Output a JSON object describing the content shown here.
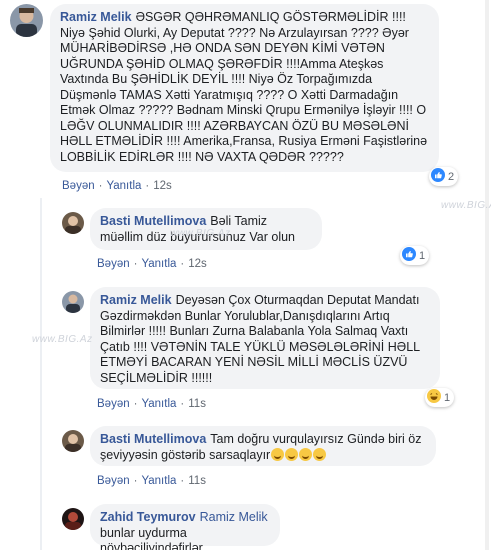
{
  "comments": [
    {
      "author": "Ramiz Melik",
      "text": "ƏSGƏR QƏHRƏMANLIQ GÖSTƏRMƏLİDİR !!!! Niyə Şəhid Olurki, Ay Deputat ???? Nə Arzulayırsan ???? Əyər MÜHARİBƏDİRSƏ ,HƏ ONDA SƏN DEYƏN KİMİ VƏTƏN UĞRUNDA ŞƏHİD OLMAQ ŞƏRƏFDİR !!!!Amma Ateşkəs Vaxtında Bu ŞƏHİDLİK DEYİL !!!! Niyə Öz Torpağımızda Düşmənlə TAMAS Xətti Yaratmışıq ???? O Xətti Darmadağın Etmək Olmaz ????? Bədnam Minski Qrupu Ermənilyə İşləyir !!!! O LƏĞV OLUNMALIDIR !!!! AZƏRBAYCAN ÖZÜ BU MƏSƏLƏNİ HƏLL ETMƏLİDİR !!!! Amerika,Fransa, Rusiya Erməni Faşistlərinə LOBBİLİK EDİRLƏR !!!! NƏ VAXTA QƏDƏR ?????",
      "like": "Bəyən",
      "reply": "Yanıtla",
      "time": "12s",
      "reaction_icon": "like-icon",
      "reaction_count": "2"
    },
    {
      "author": "Basti Mutellimova",
      "text": "Bəli Tamiz müəllim düz buyurursunuz Var olun",
      "like": "Bəyən",
      "reply": "Yanıtla",
      "time": "12s",
      "reaction_icon": "like-icon",
      "reaction_count": "1"
    },
    {
      "author": "Ramiz Melik",
      "text": "Deyəsən Çox Oturmaqdan Deputat Mandatı Gəzdirməkdən Bunlar Yorulublar,Danışdıqlarını Artıq Bilmirlər !!!!! Bunları Zurna Balabanla Yola Salmaq Vaxtı Çatıb !!!! VƏTƏNİN TALE YÜKLÜ MƏSƏLƏLƏRİNİ HƏLL ETMƏYİ BACARAN YENİ NƏSİL MİLLİ MƏCLİS ÜZVÜ SEÇİLMƏLİDİR !!!!!!",
      "like": "Bəyən",
      "reply": "Yanıtla",
      "time": "11s",
      "reaction_icon": "haha-icon",
      "reaction_count": "1"
    },
    {
      "author": "Basti Mutellimova",
      "text": "Tam doğru vurqulayırsız Gündə biri öz şeviyyəsin göstərib sarsaqlayır",
      "like": "Bəyən",
      "reply": "Yanıtla",
      "time": "11s"
    },
    {
      "author": "Zahid Teymurov",
      "mention": "Ramiz Melik",
      "text": "bunlar uydurma növbəçiliyindəfirlər."
    }
  ],
  "watermark": "www.BIG.Az",
  "colors": {
    "link": "#385898",
    "bubble": "#f2f3f5",
    "meta": "#606770",
    "like_blue": "#2d88ff"
  }
}
